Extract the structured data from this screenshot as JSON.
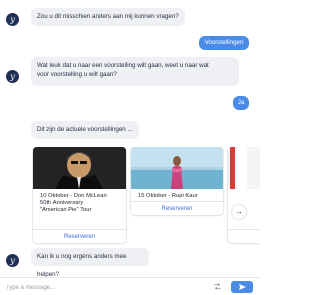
{
  "messages": [
    {
      "from": "bot",
      "text": "Zou u dit misschien anders aan mij kunnen vragen?"
    },
    {
      "from": "user",
      "text": "Voorstellingen"
    },
    {
      "from": "bot",
      "lines": [
        "Wat leuk dat u naar een voorstelling wilt gaan, weet u naar wat",
        "voor voorstelling u wilt gaan?"
      ]
    },
    {
      "from": "user",
      "text": "Ja"
    },
    {
      "from": "bot",
      "text": "Dit zijn de actuele voorstellingen ..."
    },
    {
      "from": "bot",
      "text": "Kan ik u nog ergens anders mee helpen?"
    }
  ],
  "avatar_letter": "y",
  "cards": [
    {
      "title_lines": [
        "10 Oktober - Don McLean",
        "50th Anniversary",
        "\"American Pie\" Tour"
      ],
      "button": "Reserveren"
    },
    {
      "title_lines": [
        "15 Oktober - Rupi Kaur"
      ],
      "button": "Reserveren"
    },
    {
      "title_lines": [
        ""
      ],
      "button": ""
    }
  ],
  "carousel_next_icon": "arrow-right-icon",
  "input": {
    "placeholder": "Type a message...",
    "value": ""
  },
  "colors": {
    "user_bubble": "#4a8be8",
    "bot_bubble": "#eef0f4",
    "avatar": "#1f2f56",
    "button_text": "#3a6fd0"
  }
}
